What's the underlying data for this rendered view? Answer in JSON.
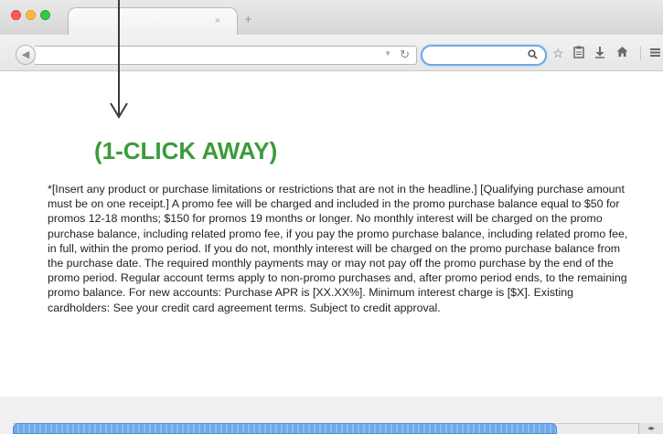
{
  "browser": {
    "tab": {
      "title": "",
      "close_glyph": "×"
    },
    "new_tab_glyph": "+",
    "toolbar": {
      "back_icon": "back-arrow-icon",
      "url_value": "",
      "search_value": "",
      "icons": [
        "bookmark-star-icon",
        "clipboard-icon",
        "download-icon",
        "home-icon",
        "menu-icon"
      ]
    },
    "scrollbar": {
      "thumb_fraction": 0.87
    },
    "colors": {
      "search_focus": "#6fa8e3",
      "scroll_thumb": "#6ea9e8"
    }
  },
  "page": {
    "headline": "(1-CLICK AWAY)",
    "headline_color": "#3b9b3b",
    "disclaimer": "*[Insert any product or purchase limitations or restrictions that are not in the headline.] [Qualifying purchase amount must be on one receipt.]  A promo fee will be charged and included in the promo purchase balance equal to $50 for promos 12-18 months; $150 for promos 19 months or longer. No monthly interest will be charged on the promo purchase balance, including related promo fee, if you pay the promo purchase balance, including related promo fee, in full, within the promo period. If you do not, monthly interest will be charged on the promo purchase balance from the purchase date. The required monthly payments may or may not pay off the promo purchase by the end of the promo period. Regular account terms apply to non-promo purchases and, after promo period ends, to the remaining promo balance. For new accounts: Purchase APR is [XX.XX%]. Minimum interest charge is [$X]. Existing cardholders: See your credit card agreement terms. Subject to credit approval."
  }
}
